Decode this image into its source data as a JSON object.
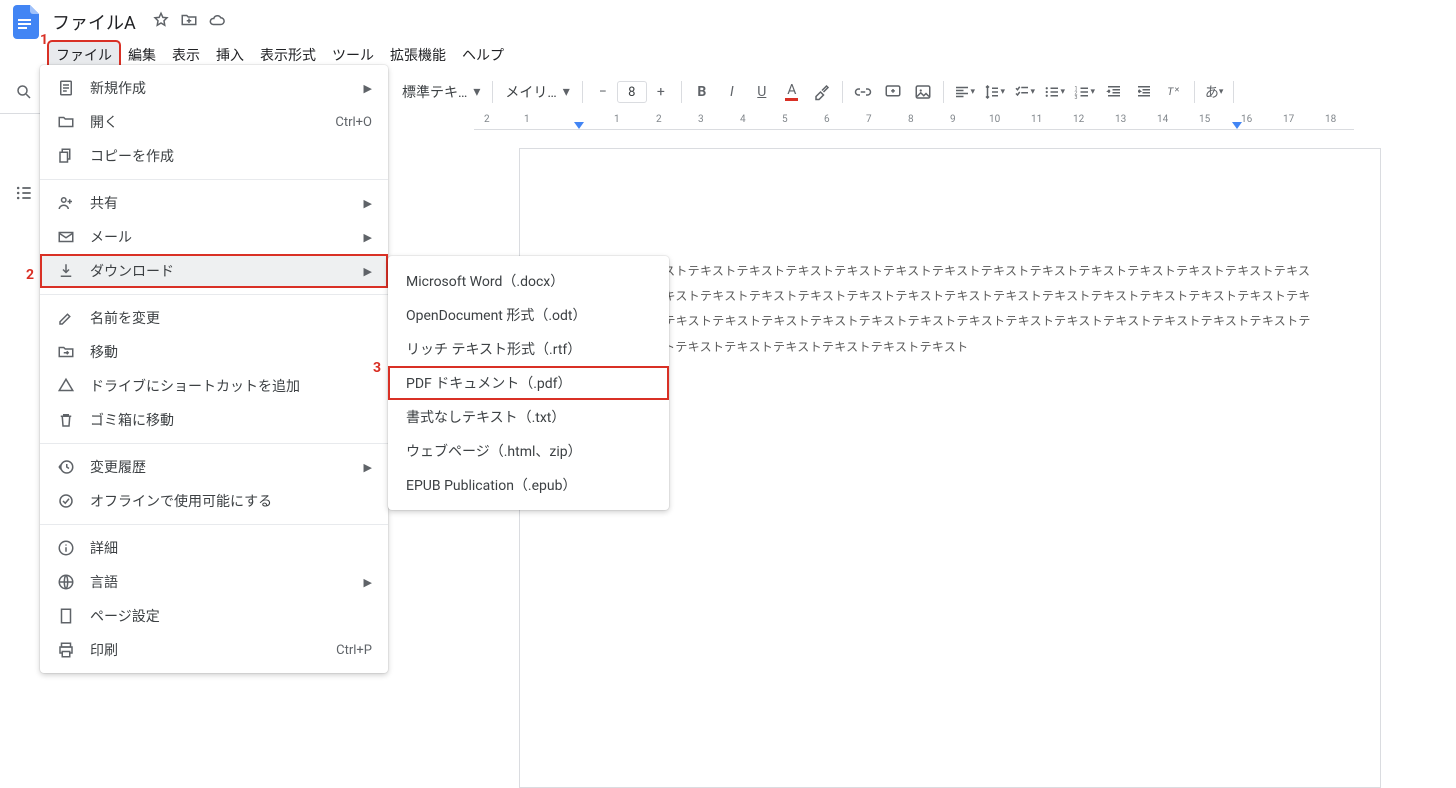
{
  "header": {
    "title": "ファイルA"
  },
  "menubar": [
    "ファイル",
    "編集",
    "表示",
    "挿入",
    "表示形式",
    "ツール",
    "拡張機能",
    "ヘルプ"
  ],
  "toolbar": {
    "style_select": "標準テキ…",
    "font_select": "メイリ…",
    "font_size": "8"
  },
  "ruler": {
    "labels": [
      "2",
      "1",
      "",
      "1",
      "2",
      "3",
      "4",
      "5",
      "6",
      "7",
      "8",
      "9",
      "10",
      "11",
      "12",
      "13",
      "14",
      "15",
      "16",
      "17",
      "18"
    ]
  },
  "annotations": {
    "n1": "1",
    "n2": "2",
    "n3": "3"
  },
  "file_menu": {
    "new": "新規作成",
    "open": "開く",
    "open_short": "Ctrl+O",
    "copy": "コピーを作成",
    "share": "共有",
    "mail": "メール",
    "download": "ダウンロード",
    "rename": "名前を変更",
    "move": "移動",
    "shortcut": "ドライブにショートカットを追加",
    "trash": "ゴミ箱に移動",
    "history": "変更履歴",
    "offline": "オフラインで使用可能にする",
    "details": "詳細",
    "language": "言語",
    "pagesetup": "ページ設定",
    "print": "印刷",
    "print_short": "Ctrl+P"
  },
  "download_menu": {
    "docx": "Microsoft Word（.docx）",
    "odt": "OpenDocument 形式（.odt）",
    "rtf": "リッチ テキスト形式（.rtf）",
    "pdf": "PDF ドキュメント（.pdf）",
    "txt": "書式なしテキスト（.txt）",
    "html": "ウェブページ（.html、zip）",
    "epub": "EPUB Publication（.epub）"
  },
  "document": {
    "body": "テキストテキストテキストテキストテキストテキストテキストテキストテキストテキストテキストテキストテキストテキストテキストテキストテキストテキストテキストテキストテキストテキストテキストテキストテキストテキストテキストテキストテキストテキストテキストテキストテキストテキストテキストテキストテキストテキストテキストテキストテキストテキストテキストテキストテキストテキストテキストテキストテキストテキストテキストテキスト"
  }
}
